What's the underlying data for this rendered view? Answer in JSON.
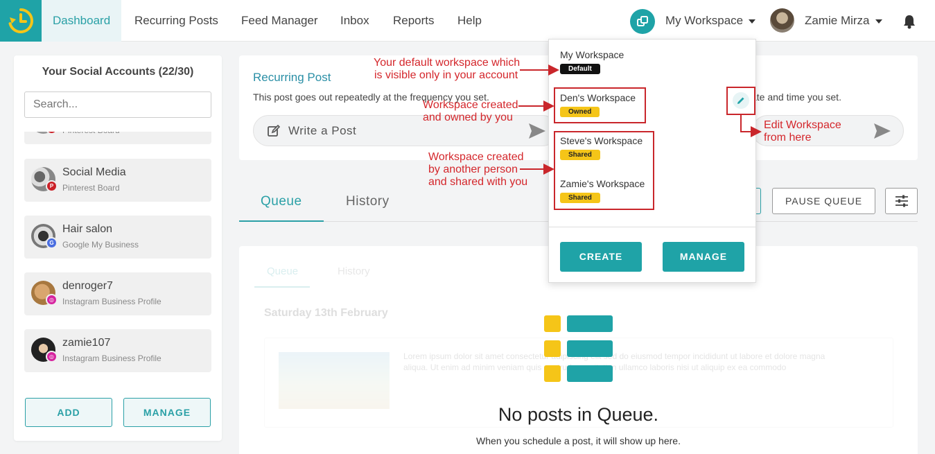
{
  "nav": {
    "items": [
      "Dashboard",
      "Recurring Posts",
      "Feed Manager",
      "Inbox",
      "Reports",
      "Help"
    ],
    "workspace": "My Workspace",
    "user": "Zamie Mirza"
  },
  "accounts": {
    "title": "Your Social Accounts (22/30)",
    "search_placeholder": "Search...",
    "partial_type": "Pinterest Board",
    "items": [
      {
        "name": "Social Media",
        "type": "Pinterest Board"
      },
      {
        "name": "Hair salon",
        "type": "Google My Business"
      },
      {
        "name": "denroger7",
        "type": "Instagram Business Profile"
      },
      {
        "name": "zamie107",
        "type": "Instagram Business Profile"
      }
    ],
    "add_label": "ADD",
    "manage_label": "MANAGE"
  },
  "recurring": {
    "title": "Recurring Post",
    "desc": "This post goes out repeatedly at the frequency you set.",
    "desc2": "ate and time you set.",
    "write_label": "Write a Post"
  },
  "tabs": {
    "queue": "Queue",
    "history": "History",
    "pause_label": "PAUSE QUEUE"
  },
  "queue": {
    "faded_tab1": "Queue",
    "faded_tab2": "History",
    "faded_date": "Saturday 13th February",
    "faded_text": "Lorem ipsum dolor sit amet consectetur adipiscing elit sed do eiusmod tempor incididunt ut labore et dolore magna aliqua. Ut enim ad minim veniam quis nostrud exercitation ullamco laboris nisi ut aliquip ex ea commodo",
    "empty_title": "No posts in Queue.",
    "empty_sub": "When you schedule a post, it will show up here."
  },
  "dropdown": {
    "workspaces": [
      {
        "name": "My Workspace",
        "tag": "Default"
      },
      {
        "name": "Den's Workspace",
        "tag": "Owned"
      },
      {
        "name": "Steve's Workspace",
        "tag": "Shared"
      },
      {
        "name": "Zamie's Workspace",
        "tag": "Shared"
      }
    ],
    "create_label": "CREATE",
    "manage_label": "MANAGE"
  },
  "annotations": {
    "default_1": "Your default workspace which",
    "default_2": "is visible only in your account",
    "owned_1": "Workspace created",
    "owned_2": "and owned by you",
    "shared_1": "Workspace created",
    "shared_2": "by another person",
    "shared_3": "and shared with you",
    "edit_1": "Edit Workspace",
    "edit_2": "from here"
  },
  "colors": {
    "brand": "#1fa3a7",
    "annotation": "#d4262b",
    "tag_yellow": "#f5c518"
  }
}
